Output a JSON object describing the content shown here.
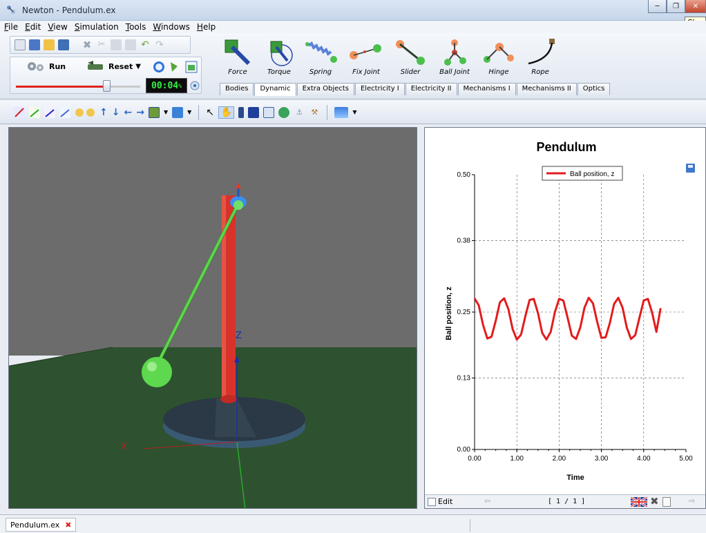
{
  "window": {
    "title": "Newton - Pendulum.ex",
    "tooltip": "Clos"
  },
  "menu": [
    "File",
    "Edit",
    "View",
    "Simulation",
    "Tools",
    "Windows",
    "Help"
  ],
  "simulation": {
    "run_label": "Run",
    "reset_label": "Reset",
    "timer": "00:04",
    "timer_suffix": "%",
    "slider_fraction": 0.73
  },
  "objects": [
    {
      "label": "Force",
      "icon": "force-icon"
    },
    {
      "label": "Torque",
      "icon": "torque-icon"
    },
    {
      "label": "Spring",
      "icon": "spring-icon"
    },
    {
      "label": "Fix Joint",
      "icon": "fix-joint-icon"
    },
    {
      "label": "Slider",
      "icon": "slider-joint-icon"
    },
    {
      "label": "Ball Joint",
      "icon": "ball-joint-icon"
    },
    {
      "label": "Hinge",
      "icon": "hinge-icon"
    },
    {
      "label": "Rope",
      "icon": "rope-icon"
    }
  ],
  "tabs": [
    {
      "label": "Bodies",
      "active": false
    },
    {
      "label": "Dynamic",
      "active": true
    },
    {
      "label": "Extra Objects",
      "active": false
    },
    {
      "label": "Electricity I",
      "active": false
    },
    {
      "label": "Electricity II",
      "active": false
    },
    {
      "label": "Mechanisms I",
      "active": false
    },
    {
      "label": "Mechanisms II",
      "active": false
    },
    {
      "label": "Optics",
      "active": false
    }
  ],
  "scene": {
    "axis_z": "Z",
    "axis_x": "X",
    "colors": {
      "sky": "#6c6c6c",
      "ground": "#2e5230",
      "pole": "#d8332a",
      "rod": "#5cd64a",
      "ball": "#5ed84e",
      "base": "#2b3845"
    }
  },
  "graph": {
    "edit_label": "Edit",
    "pager": "[ 1 / 1 ]"
  },
  "chart_data": {
    "type": "line",
    "title": "Pendulum",
    "xlabel": "Time",
    "ylabel": "Ball position, z",
    "xlim": [
      0,
      5
    ],
    "ylim": [
      0,
      0.5
    ],
    "xticks": [
      "0.00",
      "1.00",
      "2.00",
      "3.00",
      "4.00",
      "5.00"
    ],
    "yticks": [
      "0.00",
      "0.13",
      "0.25",
      "0.38",
      "0.50"
    ],
    "grid": true,
    "legend": "top-center",
    "series": [
      {
        "name": "Ball position,  z",
        "color": "#e31b1b",
        "x": [
          0,
          0.1,
          0.2,
          0.3,
          0.4,
          0.5,
          0.6,
          0.7,
          0.8,
          0.9,
          1.0,
          1.1,
          1.2,
          1.3,
          1.4,
          1.5,
          1.6,
          1.7,
          1.8,
          1.9,
          2.0,
          2.1,
          2.2,
          2.3,
          2.4,
          2.5,
          2.6,
          2.7,
          2.8,
          2.9,
          3.0,
          3.1,
          3.2,
          3.3,
          3.4,
          3.5,
          3.6,
          3.7,
          3.8,
          3.9,
          4.0,
          4.1,
          4.2,
          4.3,
          4.4
        ],
        "y": [
          0.275,
          0.262,
          0.227,
          0.202,
          0.205,
          0.234,
          0.268,
          0.275,
          0.255,
          0.219,
          0.2,
          0.209,
          0.242,
          0.272,
          0.274,
          0.248,
          0.212,
          0.2,
          0.214,
          0.25,
          0.274,
          0.271,
          0.24,
          0.207,
          0.201,
          0.222,
          0.258,
          0.276,
          0.266,
          0.232,
          0.203,
          0.204,
          0.23,
          0.265,
          0.276,
          0.258,
          0.222,
          0.201,
          0.208,
          0.24,
          0.271,
          0.274,
          0.249,
          0.214,
          0.257
        ]
      }
    ]
  }
}
